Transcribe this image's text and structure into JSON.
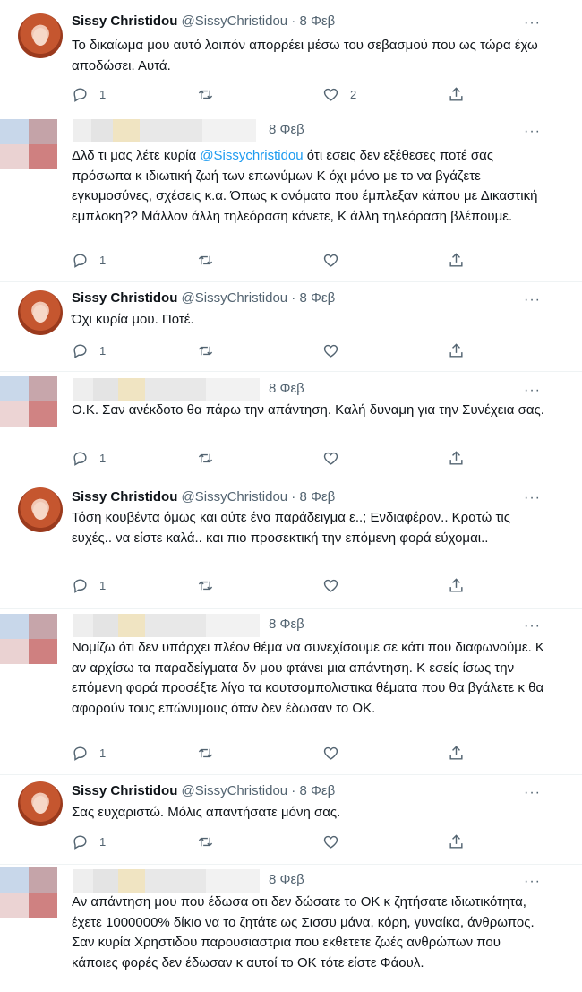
{
  "colors": {
    "accent": "#1d9bf0",
    "text": "#0f1419",
    "muted": "#536471"
  },
  "icons": {
    "more": "more-icon",
    "reply": "reply-icon",
    "retweet": "retweet-icon",
    "like": "like-icon",
    "share": "share-icon"
  },
  "tweets": [
    {
      "name": "Sissy Christidou",
      "handle": "@SissyChristidou",
      "dot": "·",
      "date": "8 Φεβ",
      "more": "···",
      "text": "Το δικαίωμα μου αυτό λοιπόν απορρέει μέσω του σεβασμού που ως τώρα έχω αποδώσει. Αυτά.",
      "replies": "1",
      "retweets": "",
      "likes": "2"
    },
    {
      "date": "8 Φεβ",
      "more": "···",
      "text_before": "Δλδ τι μας λέτε κυρία ",
      "mention": "@Sissychristidou",
      "text_after": " ότι εσεις δεν εξέθεσες ποτέ σας πρόσωπα κ ιδιωτική ζωή των επωνύμων Κ όχι μόνο με το να βγάζετε εγκυμοσύνες, σχέσεις κ.α. Όπως κ ονόματα που έμπλεξαν κάπου με Δικαστική εμπλοκη?? Μάλλον άλλη τηλεόραση κάνετε, Κ άλλη τηλεόραση βλέπουμε.",
      "replies": "1",
      "retweets": "",
      "likes": ""
    },
    {
      "name": "Sissy Christidou",
      "handle": "@SissyChristidou",
      "dot": "·",
      "date": "8 Φεβ",
      "more": "···",
      "text": "Όχι κυρία μου. Ποτέ.",
      "replies": "1",
      "retweets": "",
      "likes": ""
    },
    {
      "date": "8 Φεβ",
      "more": "···",
      "text": "Ο.Κ. Σαν ανέκδοτο θα πάρω την απάντηση. Καλή δυναμη για την Συνέχεια σας.",
      "replies": "1",
      "retweets": "",
      "likes": ""
    },
    {
      "name": "Sissy Christidou",
      "handle": "@SissyChristidou",
      "dot": "·",
      "date": "8 Φεβ",
      "more": "···",
      "text": "Τόση κουβέντα όμως και ούτε ένα παράδειγμα ε..; Ενδιαφέρον.. Κρατώ τις ευχές.. να είστε καλά.. και πιο προσεκτική την επόμενη φορά εύχομαι..",
      "replies": "1",
      "retweets": "",
      "likes": ""
    },
    {
      "date": "8 Φεβ",
      "more": "···",
      "text": "Νομίζω ότι δεν υπάρχει πλέον θέμα να συνεχίσουμε σε κάτι που διαφωνούμε. Κ αν αρχίσω τα παραδείγματα δν μου φτάνει μια απάντηση. Κ εσείς ίσως την επόμενη φορά προσέξτε λίγο τα κουτσομπολιστικα θέματα που θα βγάλετε κ θα αφορούν τους επώνυμους όταν δεν έδωσαν το ΟΚ.",
      "replies": "1",
      "retweets": "",
      "likes": ""
    },
    {
      "name": "Sissy Christidou",
      "handle": "@SissyChristidou",
      "dot": "·",
      "date": "8 Φεβ",
      "more": "···",
      "text": "Σας ευχαριστώ. Μόλις απαντήσατε μόνη σας.",
      "replies": "1",
      "retweets": "",
      "likes": ""
    },
    {
      "date": "8 Φεβ",
      "more": "···",
      "text": "Αν απάντηση μου που έδωσα οτι δεν δώσατε το ΟΚ κ ζητήσατε ιδιωτικότητα, έχετε 1000000% δίκιο να το ζητάτε ως Σισσυ μάνα, κόρη, γυναίκα, άνθρωπος. Σαν κυρία Χρηστιδου παρουσιαστρια που εκθετετε ζωές ανθρώπων που κάποιες φορές δεν έδωσαν κ αυτοί το ΟΚ τότε είστε Φάουλ."
    }
  ]
}
